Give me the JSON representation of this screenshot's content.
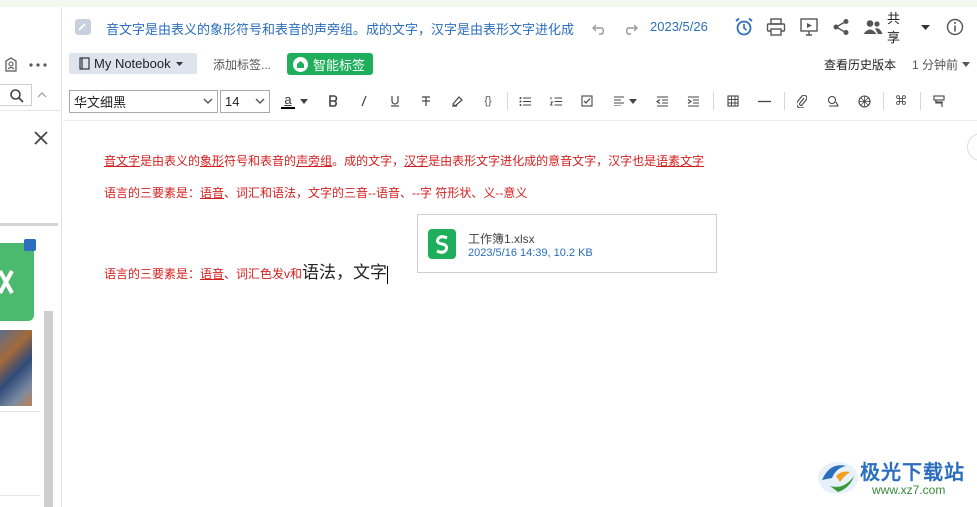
{
  "header": {
    "title": "音文字是由表义的象形符号和表音的声旁组。成的文字，汉字是由表形文字进化成",
    "date": "2023/5/26",
    "share_label": "共享"
  },
  "subbar": {
    "notebook_label": "My Notebook",
    "add_tag_label": "添加标签...",
    "smart_tag_label": "智能标签",
    "history_label": "查看历史版本",
    "time_ago_label": "1 分钟前"
  },
  "toolbar": {
    "font_family": "华文细黑",
    "font_size": "14",
    "font_color_glyph": "a",
    "brace_glyph": "{}",
    "cmd_glyph": "⌘"
  },
  "content": {
    "line1_parts": [
      "音文字",
      "是由表义的",
      "象形",
      "符号和表音的",
      "声旁组",
      "。成的文字，",
      "汉字",
      "是由表形文字进化成的意音文字，汉字也是",
      "语素文字"
    ],
    "line2_parts": [
      "语言的三要素是：",
      "语音",
      "、词汇和语法，文字的三音--语音、--字 符形状、义--意义"
    ],
    "line3_parts": [
      "语言的三要素是：",
      "语音",
      "、词汇色发v和",
      "语法，文字"
    ]
  },
  "attachment": {
    "file_name": "工作簿1.xlsx",
    "file_meta": "2023/5/16 14:39, 10.2 KB"
  },
  "watermark": {
    "brand": "极光下载站",
    "url": "www.xz7.com"
  },
  "colors": {
    "accent_blue": "#2a6ebd",
    "smart_tag_green": "#1fae5b",
    "text_red": "#d41e1e"
  }
}
